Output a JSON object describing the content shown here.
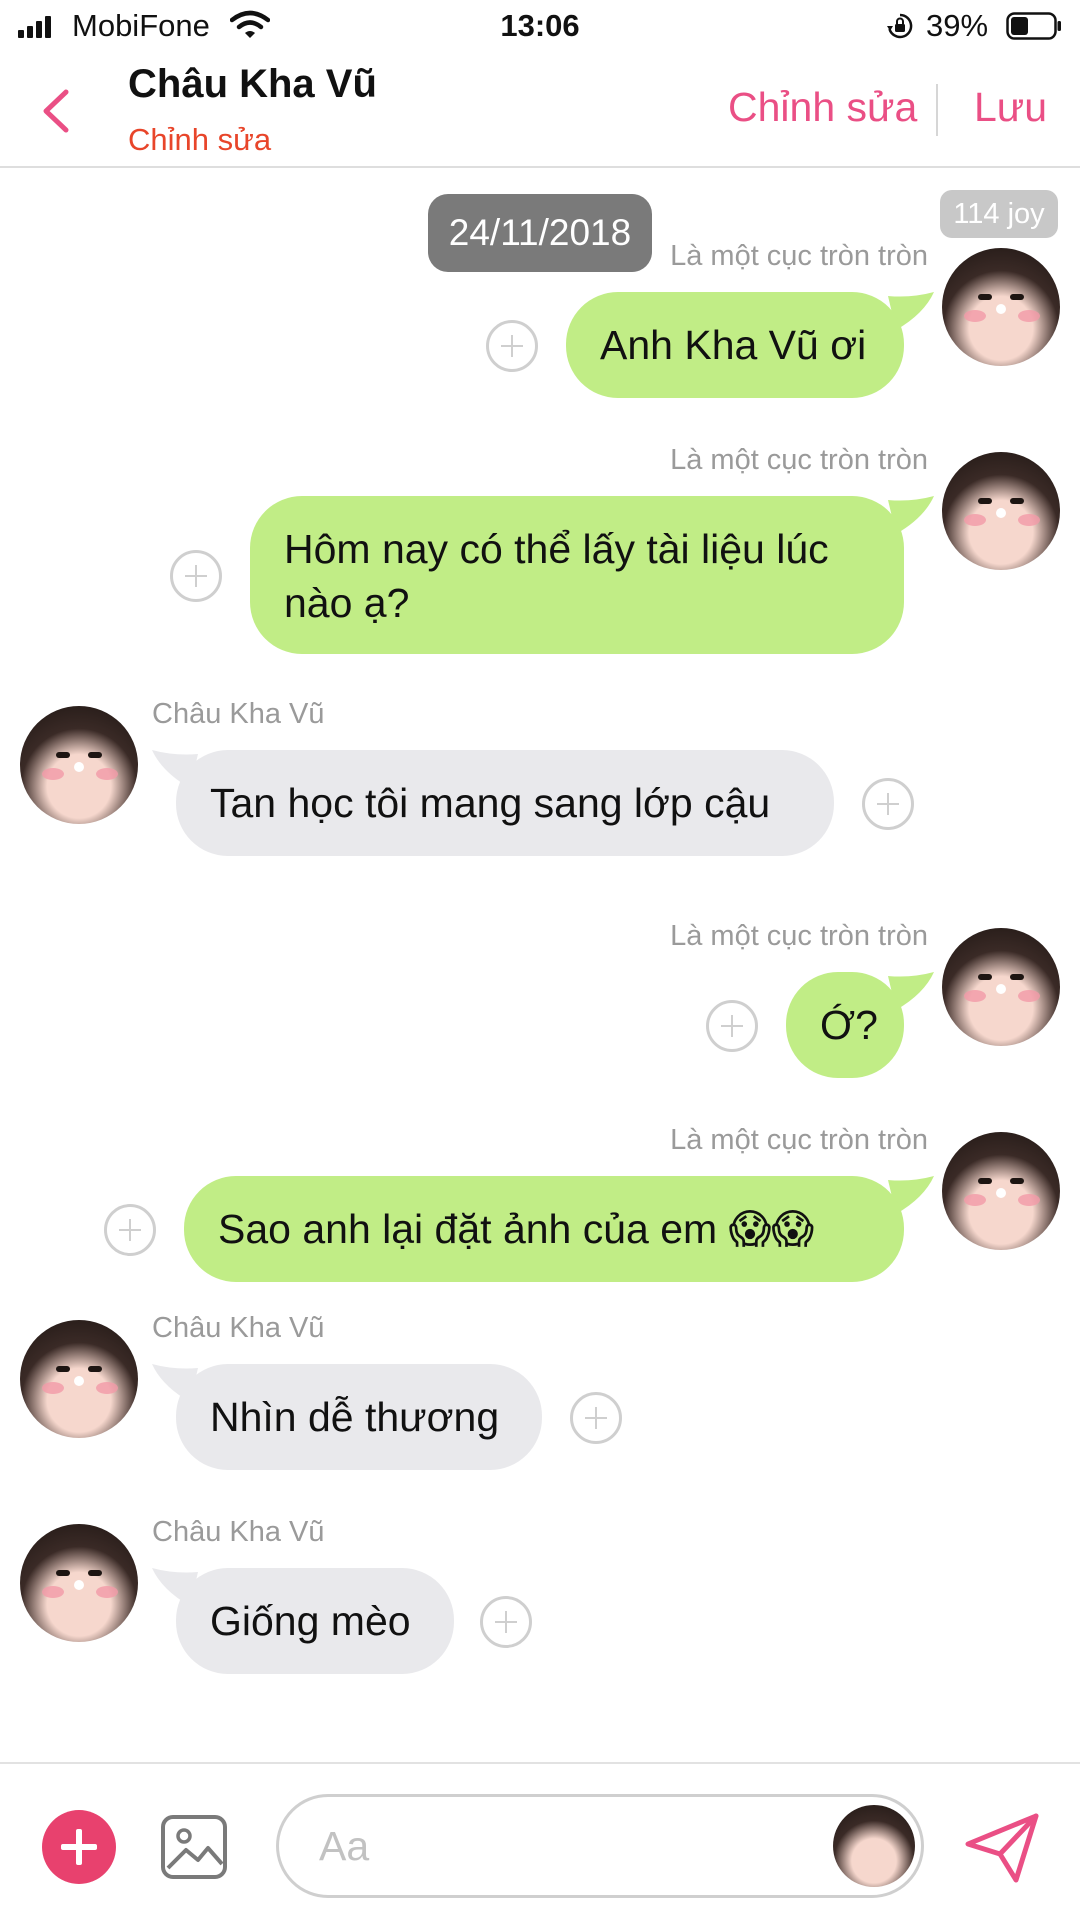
{
  "status_bar": {
    "carrier": "MobiFone",
    "time": "13:06",
    "battery": "39%"
  },
  "header": {
    "title": "Châu Kha Vũ",
    "subtitle": "Chỉnh sửa",
    "edit_label": "Chỉnh sửa",
    "save_label": "Lưu"
  },
  "chat": {
    "date": "24/11/2018",
    "counter": "114 joy",
    "messages": [
      {
        "direction": "out",
        "sender": "Là một cục tròn tròn",
        "text": "Anh Kha Vũ ơi"
      },
      {
        "direction": "out",
        "sender": "Là một cục tròn tròn",
        "text": "Hôm nay có thể lấy tài liệu lúc nào ạ?"
      },
      {
        "direction": "in",
        "sender": "Châu Kha Vũ",
        "text": "Tan học tôi mang sang lớp cậu"
      },
      {
        "direction": "out",
        "sender": "Là một cục tròn tròn",
        "text": "Ớ?"
      },
      {
        "direction": "out",
        "sender": "Là một cục tròn tròn",
        "text": "Sao anh lại đặt ảnh của em 😱😱"
      },
      {
        "direction": "in",
        "sender": "Châu Kha Vũ",
        "text": "Nhìn dễ thương"
      },
      {
        "direction": "in",
        "sender": "Châu Kha Vũ",
        "text": "Giống mèo"
      }
    ]
  },
  "composer": {
    "placeholder": "Aa"
  },
  "colors": {
    "accent": "#ea4f85",
    "subtitle": "#e8452a",
    "outgoing_bubble": "#c1ed86",
    "incoming_bubble": "#e9e9ec",
    "add_button": "#e8416e"
  },
  "icons": [
    "back-chevron-icon",
    "plus-icon",
    "image-icon",
    "send-icon",
    "wifi-icon",
    "orientation-lock-icon",
    "battery-icon"
  ]
}
